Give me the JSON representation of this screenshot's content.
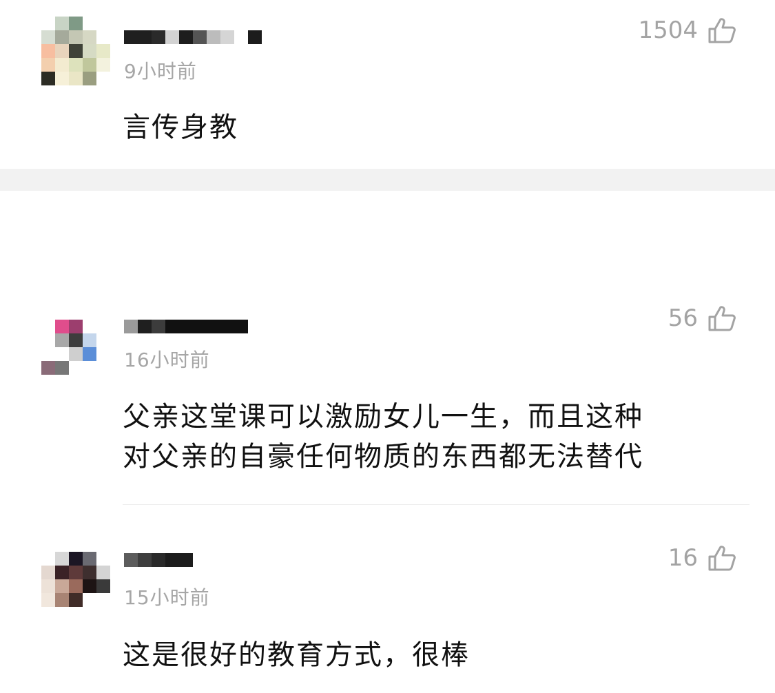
{
  "comments": [
    {
      "time": "9小时前",
      "likes": "1504",
      "text": "言传身教",
      "avatar_colors": [
        "#ffffff",
        "#c8d4c5",
        "#7f9a86",
        "#ffffff",
        "#ffffff",
        "#d6ddd2",
        "#a5aa9b",
        "#c4c7b4",
        "#d6d8c4",
        "#ffffff",
        "#f7bea0",
        "#e8d4bc",
        "#3f4238",
        "#d6dbc4",
        "#e7e9c8",
        "#f3cfae",
        "#f3ebd0",
        "#dde2bc",
        "#c0c79c",
        "#f3f2de",
        "#2c2c24",
        "#f6f0d8",
        "#eae6c6",
        "#9a9e80",
        "#ffffff"
      ],
      "username_blocks": [
        "#1f1f1f",
        "#2a2a2a",
        "#d2d2d2",
        "#1d1d1d",
        "#545454",
        "#bcbcbc",
        "#d5d5d5",
        "#ffffff",
        "#1c1c1c"
      ]
    },
    {
      "time": "16小时前",
      "likes": "56",
      "text_line1": "父亲这堂课可以激励女儿一生，而且这种",
      "text_line2": "对父亲的自豪任何物质的东西都无法替代",
      "avatar_colors": [
        "#ffffff",
        "#e04d8c",
        "#9c3e6e",
        "#ffffff",
        "#ffffff",
        "#ffffff",
        "#a8a8a8",
        "#3d3d3d",
        "#c4d6ec",
        "#ffffff",
        "#ffffff",
        "#ffffff",
        "#cfcfcf",
        "#5b8ed8",
        "#ffffff",
        "#8a6b78",
        "#777777",
        "#ffffff",
        "#ffffff",
        "#ffffff",
        "#ffffff",
        "#ffffff",
        "#ffffff",
        "#ffffff",
        "#ffffff"
      ],
      "username_blocks": [
        "#9a9a9a",
        "#1f1f1f",
        "#3c3c3c",
        "#111111",
        "#111111",
        "#111111",
        "#111111"
      ]
    },
    {
      "time": "15小时前",
      "likes": "16",
      "text": "这是很好的教育方式，很棒",
      "avatar_colors": [
        "#ffffff",
        "#d7d7d7",
        "#1b1624",
        "#6a6a72",
        "#ffffff",
        "#e4d8d0",
        "#3a2226",
        "#5e3a3a",
        "#3e2f2f",
        "#d4d4d4",
        "#ede2d8",
        "#c9a898",
        "#9a6a5c",
        "#1d1414",
        "#3a3a3a",
        "#f1e7dd",
        "#a88474",
        "#402c28",
        "#ffffff",
        "#ffffff",
        "#ffffff",
        "#ffffff",
        "#ffffff",
        "#ffffff",
        "#ffffff"
      ],
      "username_blocks": [
        "#5c5c5c",
        "#3e3e3e",
        "#2a2a2a",
        "#1c1c1c",
        "#1c1c1c"
      ]
    }
  ]
}
